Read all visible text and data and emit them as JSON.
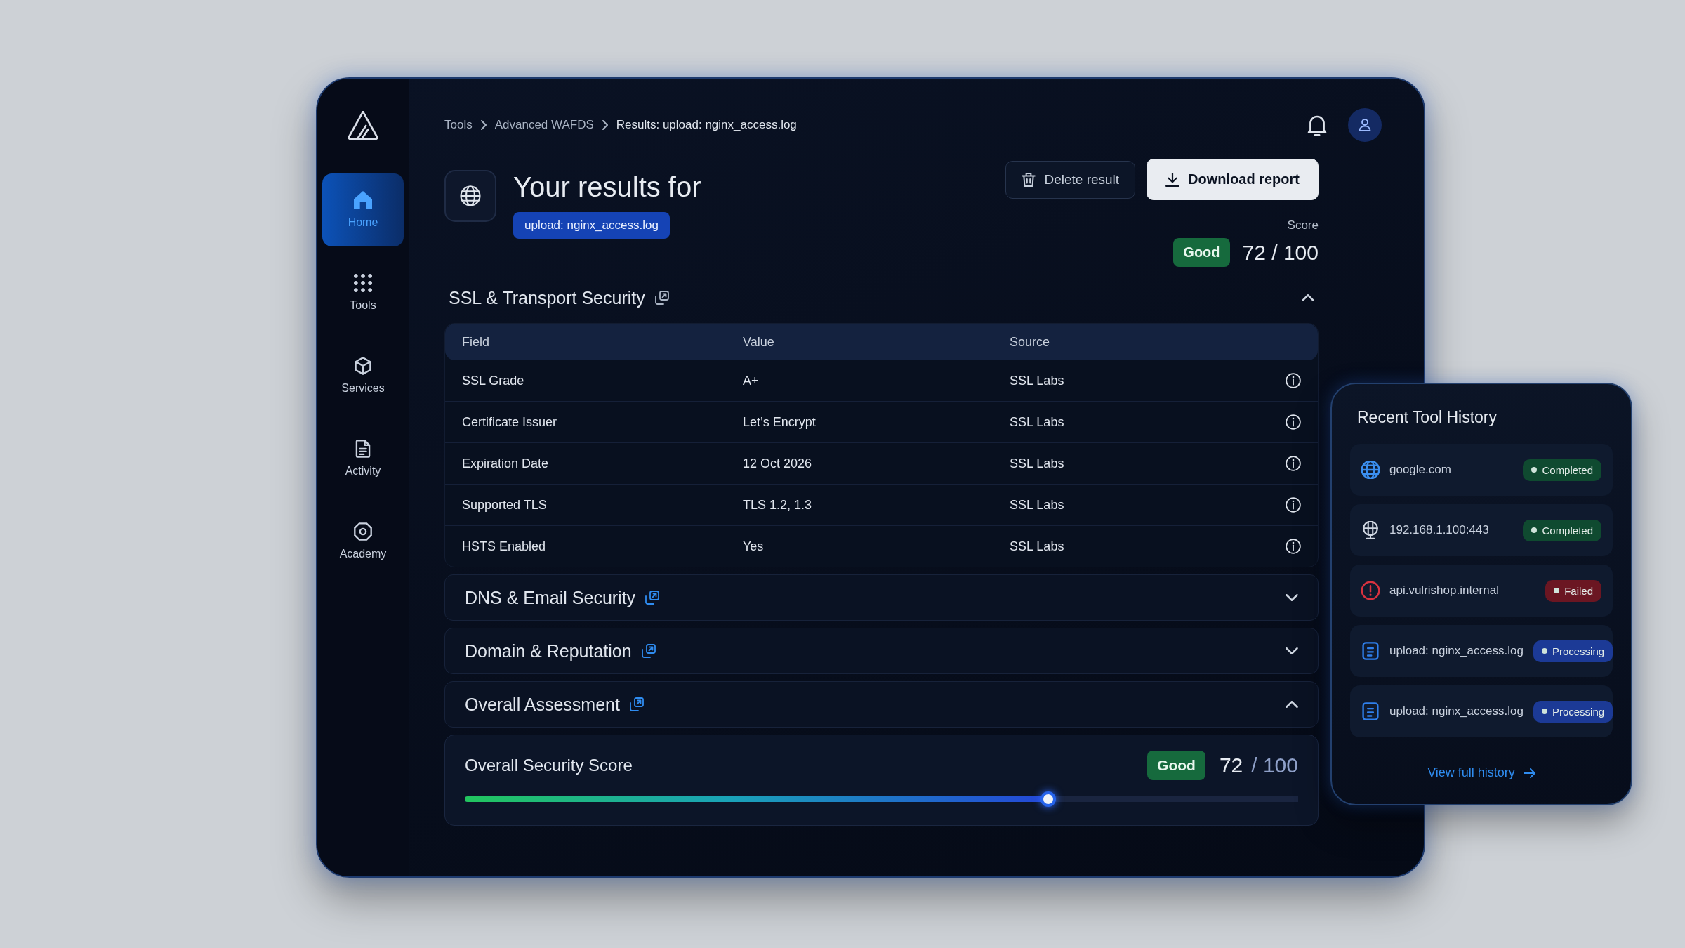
{
  "sidebar": {
    "items": [
      {
        "label": "Home",
        "kind": "home",
        "selected": true
      },
      {
        "label": "Tools",
        "kind": "grid",
        "selected": false
      },
      {
        "label": "Services",
        "kind": "cube",
        "selected": false
      },
      {
        "label": "Activity",
        "kind": "document",
        "selected": false
      },
      {
        "label": "Academy",
        "kind": "octagon",
        "selected": false
      }
    ]
  },
  "breadcrumbs": [
    "Tools",
    "Advanced WAFDS",
    "Results: upload: nginx_access.log"
  ],
  "header": {
    "title": "Your results for",
    "target": "upload: nginx_access.log",
    "actions": [
      {
        "label": "Delete result",
        "kind": "delete"
      },
      {
        "label": "Download report",
        "kind": "download"
      }
    ],
    "score": {
      "label": "Score",
      "rating": "Good",
      "value": "72 / 100"
    }
  },
  "sections": [
    {
      "title": "SSL & Transport Security",
      "expanded": true,
      "table": {
        "columns": [
          "Field",
          "Value",
          "Source"
        ],
        "rows": [
          [
            "SSL Grade",
            "A+",
            "SSL Labs"
          ],
          [
            "Certificate Issuer",
            "Let’s Encrypt",
            "SSL Labs"
          ],
          [
            "Expiration Date",
            "12 Oct 2026",
            "SSL Labs"
          ],
          [
            "Supported TLS",
            "TLS 1.2, 1.3",
            "SSL Labs"
          ],
          [
            "HSTS Enabled",
            "Yes",
            "SSL Labs"
          ]
        ]
      }
    },
    {
      "title": "DNS & Email Security",
      "expanded": false
    },
    {
      "title": "Domain & Reputation",
      "expanded": false
    },
    {
      "title": "Overall Assessment",
      "expanded": true,
      "score": {
        "title": "Overall Security Score",
        "rating": "Good",
        "value": "72",
        "total": "/ 100",
        "level": 0.7
      }
    }
  ],
  "history": {
    "title": "Recent Tool History",
    "items": [
      {
        "kind": "globe",
        "target": "google.com",
        "status": "Completed",
        "color": "#0f4a30"
      },
      {
        "kind": "globe-stand",
        "target": "192.168.1.100:443",
        "status": "Completed",
        "color": "#0f4a30"
      },
      {
        "kind": "alert",
        "target": "api.vulrishop.internal",
        "status": "Failed",
        "color": "#6b1622"
      },
      {
        "kind": "file",
        "target": "upload: nginx_access.log",
        "status": "Processing",
        "color": "#1c3a96"
      },
      {
        "kind": "file",
        "target": "upload: nginx_access.log",
        "status": "Processing",
        "color": "#1c3a96"
      }
    ],
    "link": "View full history"
  }
}
